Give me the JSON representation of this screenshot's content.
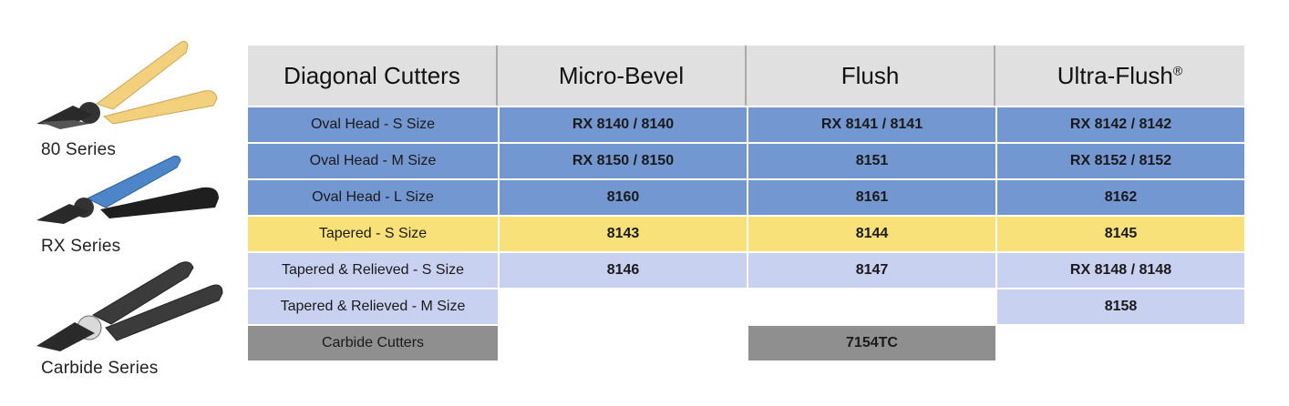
{
  "tools": [
    {
      "label": "80 Series",
      "handle_color": "#f2d07c",
      "icon": "pliers-80-series-icon"
    },
    {
      "label": "RX Series",
      "handle_color": "#4c86c9",
      "icon": "pliers-rx-series-icon"
    },
    {
      "label": "Carbide Series",
      "handle_color": "#3b3b3b",
      "icon": "pliers-carbide-series-icon"
    }
  ],
  "table": {
    "headers": [
      "Diagonal Cutters",
      "Micro-Bevel",
      "Flush",
      "Ultra-Flush"
    ],
    "header_suffix": "®",
    "rows": [
      {
        "label": "Oval Head - S Size",
        "color": "blue",
        "values": [
          "RX 8140 / 8140",
          "RX 8141 / 8141",
          "RX 8142 / 8142"
        ]
      },
      {
        "label": "Oval Head - M Size",
        "color": "blue",
        "values": [
          "RX 8150 / 8150",
          "8151",
          "RX 8152 / 8152"
        ]
      },
      {
        "label": "Oval Head - L Size",
        "color": "blue",
        "values": [
          "8160",
          "8161",
          "8162"
        ]
      },
      {
        "label": "Tapered - S Size",
        "color": "yellow",
        "values": [
          "8143",
          "8144",
          "8145"
        ]
      },
      {
        "label": "Tapered & Relieved - S Size",
        "color": "lilac",
        "values": [
          "8146",
          "8147",
          "RX 8148 / 8148"
        ]
      },
      {
        "label": "Tapered & Relieved - M Size",
        "color": "lilac",
        "values": [
          "",
          "",
          "8158"
        ]
      },
      {
        "label": "Carbide Cutters",
        "color": "gray",
        "values": [
          "",
          "7154TC",
          ""
        ]
      }
    ]
  }
}
